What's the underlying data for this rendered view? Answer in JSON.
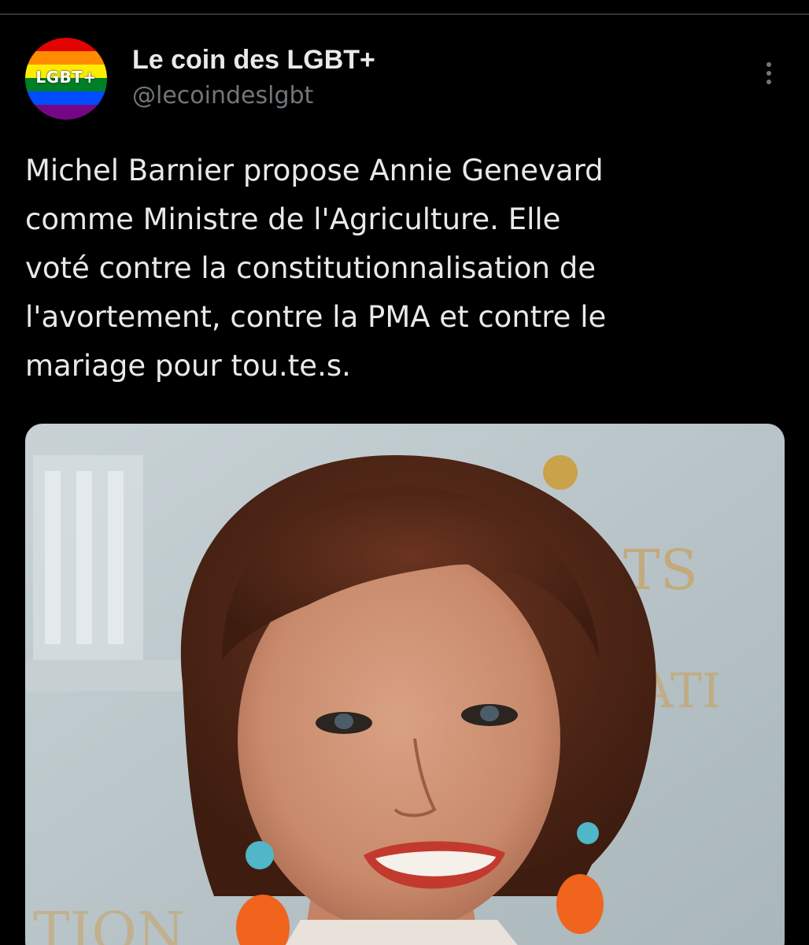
{
  "tweet": {
    "author": {
      "display_name": "Le coin des LGBT+",
      "handle": "@lecoindeslgbt",
      "avatar_text": "LGBT+",
      "avatar_colors": [
        "#e40303",
        "#ff8c00",
        "#ffed00",
        "#008026",
        "#004dff",
        "#750787"
      ]
    },
    "more_icon": "more-vertical-icon",
    "text": "Michel Barnier propose Annie Genevard\ncomme Ministre de l'Agriculture. Elle\nvoté contre la constitutionnalisation de\nl'avortement, contre la PMA et contre le\nmariage pour tou.te.s.",
    "media": {
      "alt": "Portrait photo of a smiling woman with short brown hair and colorful earrings"
    }
  },
  "colors": {
    "background": "#000000",
    "text_primary": "#e7e9ea",
    "text_secondary": "#71767b",
    "divider": "#2f3336"
  }
}
